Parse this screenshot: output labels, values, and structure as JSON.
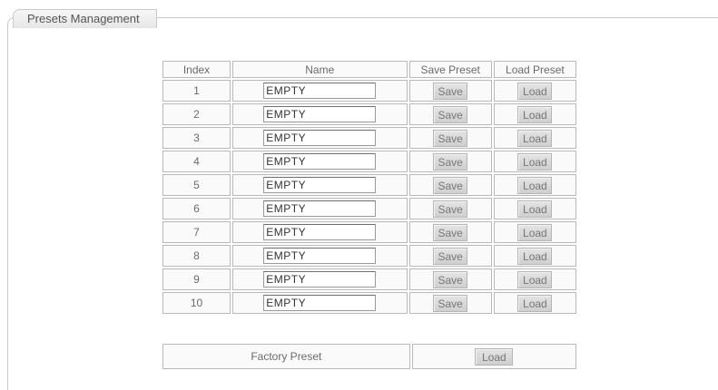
{
  "panel": {
    "title": "Presets Management"
  },
  "table": {
    "headers": {
      "index": "Index",
      "name": "Name",
      "save": "Save Preset",
      "load": "Load Preset"
    },
    "save_label": "Save",
    "load_label": "Load",
    "rows": [
      {
        "index": "1",
        "name": "EMPTY"
      },
      {
        "index": "2",
        "name": "EMPTY"
      },
      {
        "index": "3",
        "name": "EMPTY"
      },
      {
        "index": "4",
        "name": "EMPTY"
      },
      {
        "index": "5",
        "name": "EMPTY"
      },
      {
        "index": "6",
        "name": "EMPTY"
      },
      {
        "index": "7",
        "name": "EMPTY"
      },
      {
        "index": "8",
        "name": "EMPTY"
      },
      {
        "index": "9",
        "name": "EMPTY"
      },
      {
        "index": "10",
        "name": "EMPTY"
      }
    ]
  },
  "factory": {
    "label": "Factory Preset",
    "load_label": "Load"
  }
}
